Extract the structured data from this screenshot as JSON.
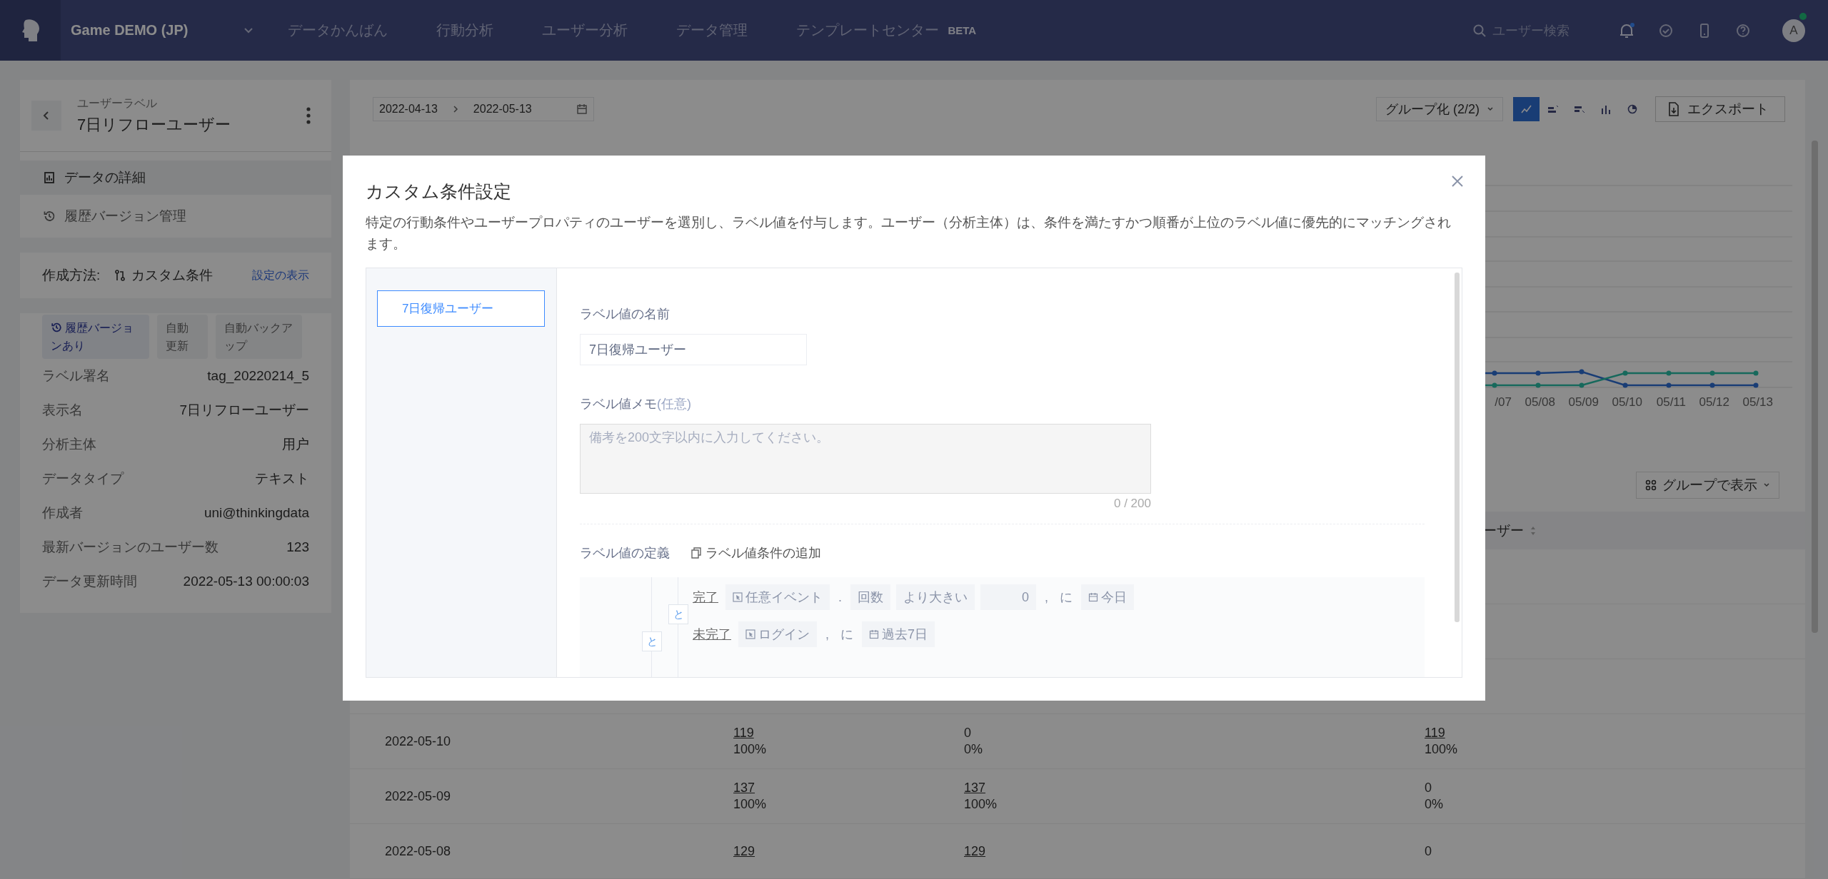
{
  "top_nav": {
    "project": "Game DEMO (JP)",
    "links": [
      {
        "label": "データかんばん"
      },
      {
        "label": "行動分析"
      },
      {
        "label": "ユーザー分析"
      },
      {
        "label": "データ管理"
      },
      {
        "label": "テンプレートセンター",
        "badge": "BETA"
      }
    ],
    "search_placeholder": "ユーザー検索",
    "avatar": "A"
  },
  "sidebar": {
    "caption": "ユーザーラベル",
    "title": "7日リフローユーザー",
    "menu": [
      {
        "label": "データの詳細",
        "kind": "report",
        "selected": true
      },
      {
        "label": "履歴バージョン管理",
        "kind": "history",
        "selected": false
      }
    ],
    "method": {
      "label": "作成方法:",
      "value": "カスタム条件",
      "link": "設定の表示"
    },
    "tags": [
      {
        "label": "履歴バージョンあり",
        "kind": "history"
      },
      {
        "label": "自動更新",
        "kind": "plain"
      },
      {
        "label": "自動バックアップ",
        "kind": "plain"
      }
    ],
    "properties": [
      {
        "name": "ラベル署名",
        "value": "tag_20220214_5"
      },
      {
        "name": "表示名",
        "value": "7日リフローユーザー"
      },
      {
        "name": "分析主体",
        "value": "用户"
      },
      {
        "name": "データタイプ",
        "value": "テキスト"
      },
      {
        "name": "作成者",
        "value": "uni@thinkingdata"
      },
      {
        "name": "最新バージョンのユーザー数",
        "value": "123"
      },
      {
        "name": "データ更新時間",
        "value": "2022-05-13 00:00:03"
      }
    ]
  },
  "content": {
    "date_start": "2022-04-13",
    "date_end": "2022-05-13",
    "group_by": "グループ化 (2/2)",
    "chart_types": [
      {
        "kind": "line",
        "selected": true
      },
      {
        "kind": "bar-group",
        "selected": false
      },
      {
        "kind": "bar-group-alt",
        "selected": false
      },
      {
        "kind": "bar",
        "selected": false
      },
      {
        "kind": "pie",
        "selected": false
      }
    ],
    "export": "エクスポート",
    "chart": {
      "x_labels": [
        "/07",
        "05/08",
        "05/09",
        "05/10",
        "05/11",
        "05/12",
        "05/13"
      ]
    },
    "group_display": "グループで表示",
    "table": {
      "column_4": "ーザー",
      "rows": [
        {
          "date": "2022-05-10",
          "cells": [
            {
              "value": "119",
              "link": true,
              "percent": "100%"
            },
            {
              "value": "0",
              "link": false,
              "percent": "0%"
            },
            {
              "value": "119",
              "link": true,
              "percent": "100%"
            }
          ]
        },
        {
          "date": "2022-05-09",
          "cells": [
            {
              "value": "137",
              "link": true,
              "percent": "100%"
            },
            {
              "value": "137",
              "link": true,
              "percent": "100%"
            },
            {
              "value": "0",
              "link": false,
              "percent": "0%"
            }
          ]
        },
        {
          "date": "2022-05-08",
          "cells": [
            {
              "value": "129",
              "link": true
            },
            {
              "value": "129",
              "link": true
            },
            {
              "value": "0",
              "link": false
            }
          ]
        }
      ]
    }
  },
  "modal": {
    "title": "カスタム条件設定",
    "description": "特定の行動条件やユーザープロパティのユーザーを選別し、ラベル値を付与します。ユーザー（分析主体）は、条件を満たすかつ順番が上位のラベル値に優先的にマッチングされます。",
    "values": [
      {
        "label": "7日復帰ユーザー",
        "selected": true
      }
    ],
    "name_label": "ラベル値の名前",
    "name_value": "7日復帰ユーザー",
    "memo_label": "ラベル値メモ",
    "memo_optional": "(任意)",
    "memo_placeholder": "備考を200文字以内に入力してください。",
    "memo_count": "0 / 200",
    "definition_label": "ラベル値の定義",
    "add_condition": "ラベル値条件の追加",
    "logic": {
      "join": "と",
      "children": [
        {
          "join": "と",
          "rows": [
            [
              {
                "kind": "action",
                "text": "完了"
              },
              {
                "kind": "event",
                "text": "任意イベント"
              },
              {
                "kind": "sep",
                "text": "."
              },
              {
                "kind": "chip",
                "text": "回数"
              },
              {
                "kind": "chip",
                "text": "より大きい"
              },
              {
                "kind": "number",
                "text": "0"
              },
              {
                "kind": "sep",
                "text": ","
              },
              {
                "kind": "sep",
                "text": "に"
              },
              {
                "kind": "date",
                "text": "今日"
              }
            ],
            [
              {
                "kind": "action",
                "text": "未完了"
              },
              {
                "kind": "event",
                "text": "ログイン"
              },
              {
                "kind": "sep",
                "text": ","
              },
              {
                "kind": "sep",
                "text": "に"
              },
              {
                "kind": "date",
                "text": "過去7日"
              }
            ]
          ]
        }
      ]
    }
  }
}
